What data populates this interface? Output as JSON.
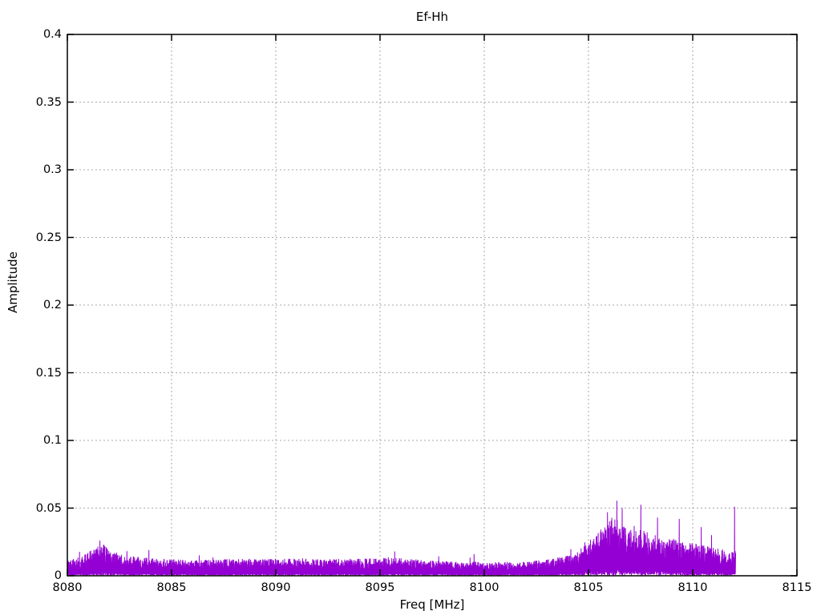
{
  "chart_data": {
    "type": "line",
    "title": "Ef-Hh",
    "xlabel": "Freq [MHz]",
    "ylabel": "Amplitude",
    "xlim": [
      8080,
      8115
    ],
    "ylim": [
      0,
      0.4
    ],
    "grid": true,
    "legend": "none",
    "background_color": "#ffffff",
    "border_color": "#000000",
    "grid_color": "#a8a8a8",
    "xticks": [
      {
        "v": 8080,
        "label": "8080"
      },
      {
        "v": 8085,
        "label": "8085"
      },
      {
        "v": 8090,
        "label": "8090"
      },
      {
        "v": 8095,
        "label": "8095"
      },
      {
        "v": 8100,
        "label": "8100"
      },
      {
        "v": 8105,
        "label": "8105"
      },
      {
        "v": 8110,
        "label": "8110"
      },
      {
        "v": 8115,
        "label": "8115"
      }
    ],
    "yticks": [
      {
        "v": 0,
        "label": "0"
      },
      {
        "v": 0.05,
        "label": "0.05"
      },
      {
        "v": 0.1,
        "label": "0.1"
      },
      {
        "v": 0.15,
        "label": "0.15"
      },
      {
        "v": 0.2,
        "label": "0.2"
      },
      {
        "v": 0.25,
        "label": "0.25"
      },
      {
        "v": 0.3,
        "label": "0.3"
      },
      {
        "v": 0.35,
        "label": "0.35"
      },
      {
        "v": 0.4,
        "label": "0.4"
      }
    ],
    "series": [
      {
        "name": "Ef-Hh",
        "color": "#9400d3",
        "style": "dense-noise-trace",
        "x_start": 8080,
        "x_end": 8112.05,
        "noise_floor": 0.0005,
        "envelope": {
          "x": [
            8080.0,
            8080.6,
            8081.2,
            8081.6,
            8082.0,
            8082.7,
            8083.6,
            8084.5,
            8086.0,
            8088.0,
            8090.0,
            8092.0,
            8094.0,
            8095.5,
            8097.0,
            8099.0,
            8100.5,
            8102.0,
            8103.3,
            8104.3,
            8105.0,
            8105.6,
            8106.1,
            8106.5,
            8107.0,
            8107.6,
            8108.2,
            8109.0,
            8110.0,
            8111.0,
            8111.8,
            8112.05
          ],
          "amp": [
            0.01,
            0.012,
            0.017,
            0.021,
            0.017,
            0.013,
            0.012,
            0.011,
            0.01,
            0.011,
            0.011,
            0.011,
            0.011,
            0.012,
            0.01,
            0.009,
            0.009,
            0.009,
            0.011,
            0.014,
            0.022,
            0.03,
            0.038,
            0.036,
            0.031,
            0.029,
            0.026,
            0.024,
            0.021,
            0.018,
            0.016,
            0.016
          ]
        },
        "peaks": [
          {
            "x": 8081.55,
            "y": 0.026
          },
          {
            "x": 8081.75,
            "y": 0.023
          },
          {
            "x": 8083.9,
            "y": 0.019
          },
          {
            "x": 8095.7,
            "y": 0.018
          },
          {
            "x": 8099.5,
            "y": 0.016
          },
          {
            "x": 8105.9,
            "y": 0.047
          },
          {
            "x": 8106.35,
            "y": 0.0555
          },
          {
            "x": 8106.6,
            "y": 0.05
          },
          {
            "x": 8107.5,
            "y": 0.0525
          },
          {
            "x": 8108.3,
            "y": 0.043
          },
          {
            "x": 8109.35,
            "y": 0.042
          },
          {
            "x": 8110.4,
            "y": 0.036
          },
          {
            "x": 8110.9,
            "y": 0.03
          },
          {
            "x": 8112.0,
            "y": 0.051
          }
        ]
      }
    ]
  }
}
